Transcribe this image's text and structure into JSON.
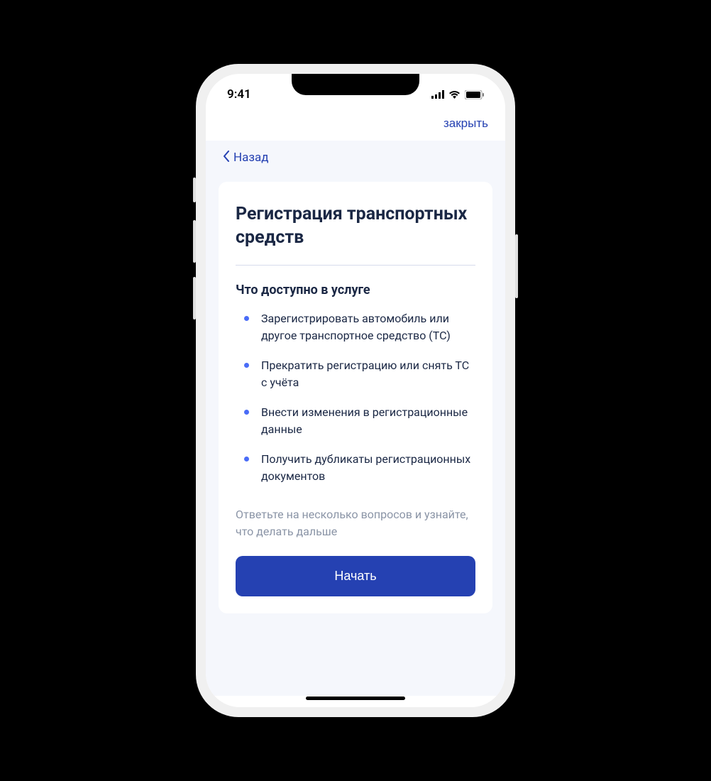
{
  "status_bar": {
    "time": "9:41"
  },
  "header": {
    "close_label": "закрыть",
    "back_label": "Назад"
  },
  "card": {
    "title": "Регистрация транспортных средств",
    "section_title": "Что доступно в услуге",
    "bullets": [
      "Зарегистрировать автомобиль или другое транспортное средство (ТС)",
      "Прекратить регистрацию или снять ТС с учёта",
      "Внести изменения в регистрационные данные",
      "Получить дубликаты регистрационных документов"
    ],
    "hint": "Ответьте на несколько вопросов и узнайте, что делать дальше",
    "start_label": "Начать"
  }
}
